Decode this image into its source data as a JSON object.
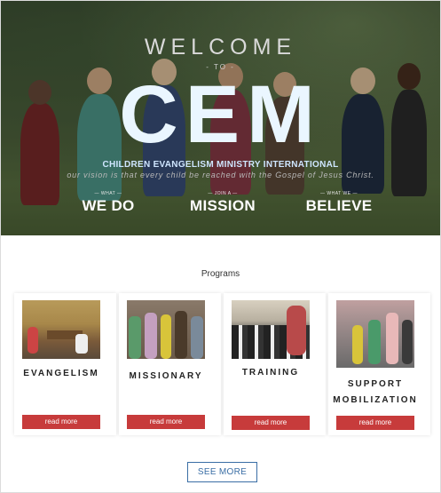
{
  "hero": {
    "welcome": "WELCOME",
    "to": "- TO -",
    "brand": "CEM",
    "org_name": "CHILDREN EVANGELISM MINISTRY INTERNATIONAL",
    "vision": "our vision is that every child be reached with the Gospel of Jesus Christ.",
    "ctas": [
      {
        "small": "— WHAT —",
        "big": "WE DO"
      },
      {
        "small": "— JOIN A —",
        "big": "MISSION"
      },
      {
        "small": "— WHAT WE —",
        "big": "BELIEVE"
      }
    ]
  },
  "programs": {
    "title": "Programs",
    "cards": [
      {
        "label_lines": [
          "EVANGELISM"
        ],
        "button": "read more"
      },
      {
        "label_lines": [
          "MISSIONARY"
        ],
        "button": "read more"
      },
      {
        "label_lines": [
          "TRAINING"
        ],
        "button": "read more"
      },
      {
        "label_lines": [
          "SUPPORT",
          "MOBILIZATION"
        ],
        "button": "read more"
      }
    ],
    "see_more": "SEE MORE"
  },
  "colors": {
    "accent_red": "#c73b3b",
    "link_blue": "#3a6ea5",
    "brand_text": "#eaf6ff"
  }
}
